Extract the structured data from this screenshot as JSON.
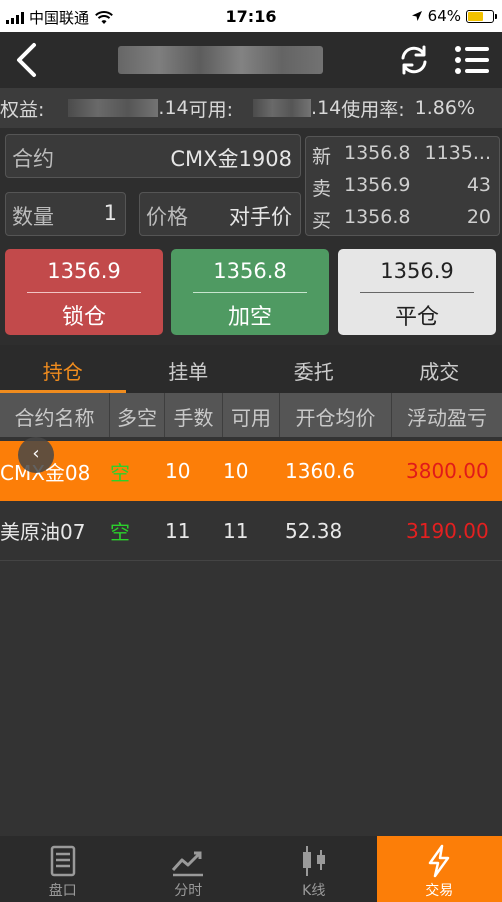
{
  "status": {
    "carrier": "中国联通",
    "time": "17:16",
    "battery": "64%",
    "battery_level": 0.64
  },
  "account": {
    "equity_label": "权益:",
    "equity_tail": ".14",
    "available_label": "可用:",
    "available_tail": ".14",
    "usage_label": "使用率:",
    "usage_value": "1.86%"
  },
  "order": {
    "contract_label": "合约",
    "contract_value": "CMX金1908",
    "qty_label": "数量",
    "qty_value": "1",
    "price_label": "价格",
    "price_value": "对手价"
  },
  "quote": {
    "rows": [
      {
        "label": "新",
        "price": "1356.8",
        "value": "1135..."
      },
      {
        "label": "卖",
        "price": "1356.9",
        "value": "43"
      },
      {
        "label": "买",
        "price": "1356.8",
        "value": "20"
      }
    ]
  },
  "buttons": {
    "lock": {
      "price": "1356.9",
      "label": "锁仓"
    },
    "add_short": {
      "price": "1356.8",
      "label": "加空"
    },
    "close": {
      "price": "1356.9",
      "label": "平仓"
    }
  },
  "tabs": [
    {
      "label": "持仓",
      "active": true
    },
    {
      "label": "挂单",
      "active": false
    },
    {
      "label": "委托",
      "active": false
    },
    {
      "label": "成交",
      "active": false
    }
  ],
  "table": {
    "headers": [
      "合约名称",
      "多空",
      "手数",
      "可用",
      "开仓均价",
      "浮动盈亏"
    ],
    "rows": [
      {
        "name": "CMX金08",
        "side": "空",
        "lots": "10",
        "avail": "10",
        "avg": "1360.6",
        "pnl": "3800.00"
      },
      {
        "name": "美原油07",
        "side": "空",
        "lots": "11",
        "avail": "11",
        "avg": "52.38",
        "pnl": "3190.00"
      }
    ]
  },
  "tabbar": [
    {
      "label": "盘口",
      "icon": "list-icon",
      "active": false
    },
    {
      "label": "分时",
      "icon": "line-chart-icon",
      "active": false
    },
    {
      "label": "K线",
      "icon": "candlestick-icon",
      "active": false
    },
    {
      "label": "交易",
      "icon": "lightning-icon",
      "active": true
    }
  ],
  "colors": {
    "accent": "#fc7e08",
    "sell": "#c24a4b",
    "buy": "#4f9a62",
    "short": "#2bd12b",
    "pnl": "#e32020"
  }
}
